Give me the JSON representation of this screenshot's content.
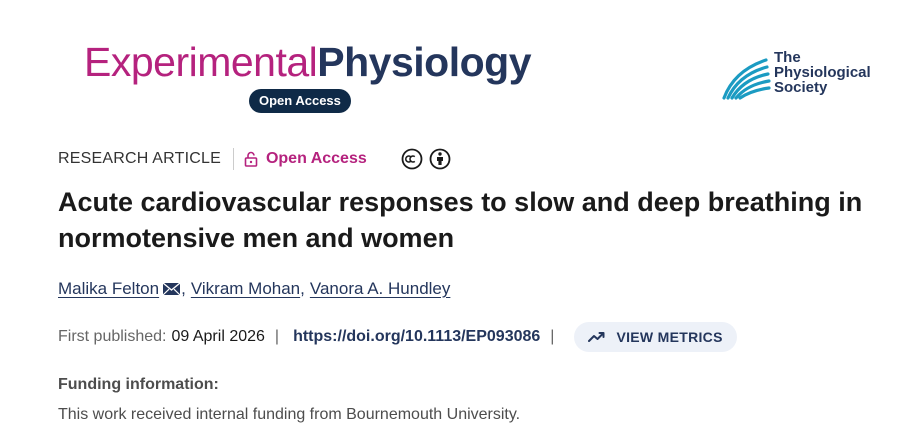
{
  "journal": {
    "title_part1": "Experimental",
    "title_part2": "Physiology",
    "badge": "Open Access"
  },
  "society": {
    "line1": "The",
    "line2": "Physiological",
    "line3": "Society"
  },
  "article_meta": {
    "type": "RESEARCH ARTICLE",
    "access": "Open Access",
    "license_icons": [
      "cc-icon",
      "attribution-icon"
    ]
  },
  "article": {
    "title": "Acute cardiovascular responses to slow and deep breathing in normotensive men and women"
  },
  "authors": [
    {
      "name": "Malika Felton",
      "corresponding": true
    },
    {
      "name": "Vikram Mohan",
      "corresponding": false
    },
    {
      "name": "Vanora A. Hundley",
      "corresponding": false
    }
  ],
  "author_separator": ",",
  "publication": {
    "label": "First published:",
    "date": "09 April 2026",
    "divider": "|",
    "doi": "https://doi.org/10.1113/EP093086",
    "metrics_button": "VIEW METRICS"
  },
  "funding": {
    "heading": "Funding information:",
    "text": "This work received internal funding from Bournemouth University."
  },
  "colors": {
    "magenta": "#b5227e",
    "navy": "#24365c",
    "dark_navy": "#0f2a47",
    "teal": "#1b9bc2",
    "pill_bg": "#edf1f8"
  }
}
